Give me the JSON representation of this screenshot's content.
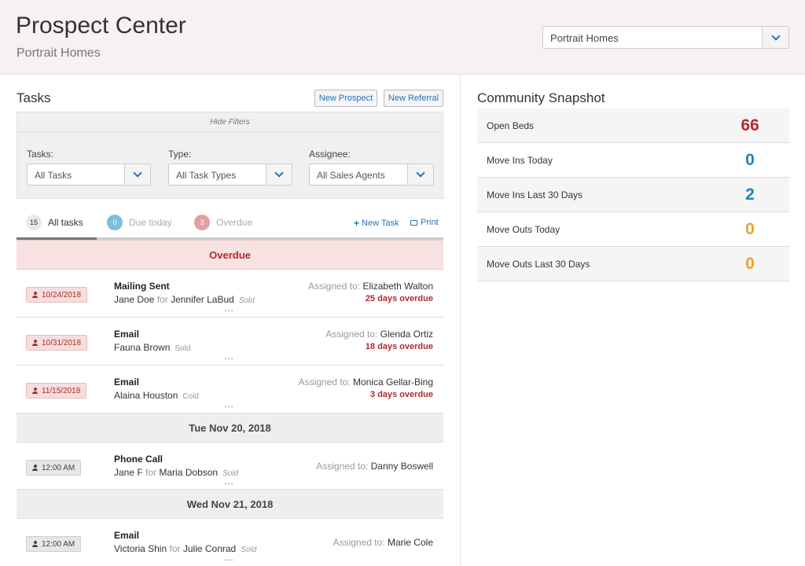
{
  "header": {
    "title": "Prospect Center",
    "subtitle": "Portrait Homes",
    "community_select": "Portrait Homes"
  },
  "tasks": {
    "title": "Tasks",
    "new_prospect": "New Prospect",
    "new_referral": "New Referral",
    "hide_filters": "Hide Filters",
    "filters": {
      "tasks_label": "Tasks:",
      "tasks_value": "All Tasks",
      "type_label": "Type:",
      "type_value": "All Task Types",
      "assignee_label": "Assignee:",
      "assignee_value": "All Sales Agents"
    },
    "tabs": {
      "all_count": "15",
      "all_label": "All tasks",
      "due_count": "0",
      "due_label": "Due today",
      "over_count": "3",
      "over_label": "Overdue"
    },
    "new_task": "New Task",
    "print": "Print",
    "groups": {
      "overdue": "Overdue",
      "date1": "Tue Nov 20, 2018",
      "date2": "Wed Nov 21, 2018"
    },
    "assigned_label": "Assigned to:",
    "for_word": "for",
    "dots": "•••",
    "rows": [
      {
        "badge": "10/24/2018",
        "type": "Mailing Sent",
        "prospect": "Jane Doe",
        "for": "Jennifer LaBud",
        "status": "Sold",
        "assignee": "Elizabeth Walton",
        "overdue": "25 days overdue"
      },
      {
        "badge": "10/31/2018",
        "type": "Email",
        "prospect": "Fauna Brown",
        "status": "Sold",
        "assignee": "Glenda Ortiz",
        "overdue": "18 days overdue"
      },
      {
        "badge": "11/15/2018",
        "type": "Email",
        "prospect": "Alaina Houston",
        "status": "Cold",
        "assignee": "Monica Gellar-Bing",
        "overdue": "3 days overdue"
      },
      {
        "badge": "12:00 AM",
        "type": "Phone Call",
        "prospect": "Jane F",
        "for": "Maria Dobson",
        "status": "Sold",
        "assignee": "Danny Boswell"
      },
      {
        "badge": "12:00 AM",
        "type": "Email",
        "prospect": "Victoria Shin",
        "for": "Julie Conrad",
        "status": "Sold",
        "assignee": "Marie Cole"
      }
    ]
  },
  "snapshot": {
    "title": "Community Snapshot",
    "items": [
      {
        "label": "Open Beds",
        "value": "66"
      },
      {
        "label": "Move Ins Today",
        "value": "0"
      },
      {
        "label": "Move Ins Last 30 Days",
        "value": "2"
      },
      {
        "label": "Move Outs Today",
        "value": "0"
      },
      {
        "label": "Move Outs Last 30 Days",
        "value": "0"
      }
    ]
  },
  "colors": {
    "overdue_red": "#b22a2a",
    "move_in_blue": "#1f86b8",
    "move_out_orange": "#f0a02c",
    "link_blue": "#2a72b5"
  }
}
